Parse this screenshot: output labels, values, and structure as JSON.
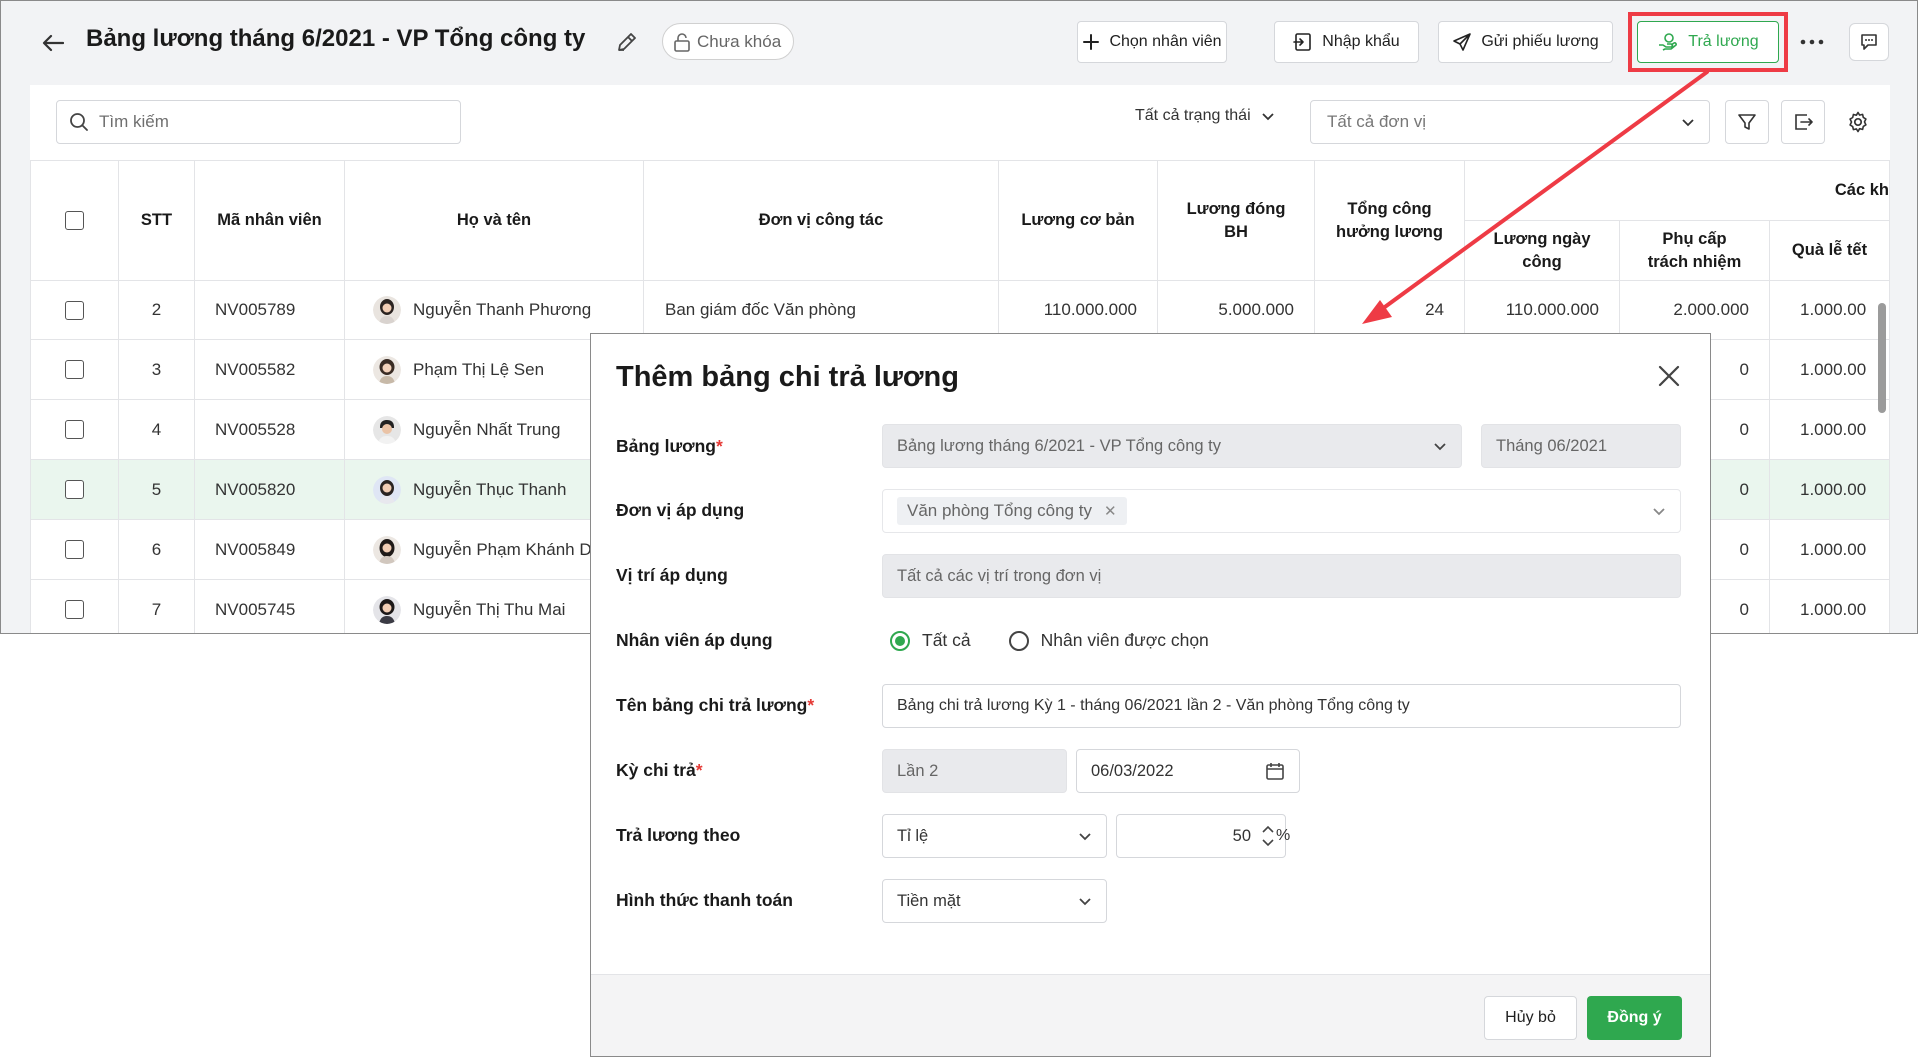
{
  "header": {
    "title": "Bảng lương tháng 6/2021 - VP Tổng công ty",
    "lock_status": "Chưa khóa",
    "buttons": {
      "choose_employee": "Chọn nhân viên",
      "import": "Nhập khẩu",
      "send_payslip": "Gửi phiếu lương",
      "pay_salary": "Trả lương"
    }
  },
  "toolbar": {
    "search_placeholder": "Tìm kiếm",
    "status_filter": "Tất cả trạng thái",
    "unit_filter": "Tất cả đơn vị"
  },
  "table": {
    "columns": {
      "stt": "STT",
      "employee_code": "Mã nhân viên",
      "full_name": "Họ và tên",
      "department": "Đơn vị công tác",
      "base_salary": "Lương cơ bản",
      "insurance_salary": "Lương đóng BH",
      "total_workdays": "Tổng công hưởng lương",
      "group_header": "Các kh",
      "daily_wage": "Lương ngày công",
      "responsibility_allowance": "Phụ cấp trách nhiệm",
      "holiday_gift": "Quà lễ tết"
    },
    "rows": [
      {
        "stt": "2",
        "code": "NV005789",
        "name": "Nguyễn Thanh Phương",
        "dept": "Ban giám đốc Văn phòng",
        "base": "110.000.000",
        "ins": "5.000.000",
        "days": "24",
        "daily": "110.000.000",
        "allow": "2.000.000",
        "gift": "1.000.00"
      },
      {
        "stt": "3",
        "code": "NV005582",
        "name": "Phạm Thị Lệ Sen",
        "dept": "",
        "base": "",
        "ins": "",
        "days": "",
        "daily": "",
        "allow": "0",
        "gift": "1.000.00"
      },
      {
        "stt": "4",
        "code": "NV005528",
        "name": "Nguyễn Nhất Trung",
        "dept": "",
        "base": "",
        "ins": "",
        "days": "",
        "daily": "",
        "allow": "0",
        "gift": "1.000.00"
      },
      {
        "stt": "5",
        "code": "NV005820",
        "name": "Nguyễn Thục Thanh",
        "dept": "",
        "base": "",
        "ins": "",
        "days": "",
        "daily": "",
        "allow": "0",
        "gift": "1.000.00"
      },
      {
        "stt": "6",
        "code": "NV005849",
        "name": "Nguyễn Phạm Khánh D",
        "dept": "",
        "base": "",
        "ins": "",
        "days": "",
        "daily": "",
        "allow": "0",
        "gift": "1.000.00"
      },
      {
        "stt": "7",
        "code": "NV005745",
        "name": "Nguyễn Thị Thu Mai",
        "dept": "",
        "base": "",
        "ins": "",
        "days": "",
        "daily": "",
        "allow": "0",
        "gift": "1.000.00"
      }
    ]
  },
  "modal": {
    "title": "Thêm bảng chi trả lương",
    "fields": {
      "payroll_label": "Bảng lương",
      "payroll_value": "Bảng lương tháng 6/2021 - VP Tổng công ty",
      "payroll_month": "Tháng 06/2021",
      "unit_label": "Đơn vị áp dụng",
      "unit_chip": "Văn phòng Tổng công ty",
      "position_label": "Vị trí áp dụng",
      "position_value": "Tất cả các vị trí trong đơn vị",
      "employee_label": "Nhân viên áp dụng",
      "employee_option_all": "Tất cả",
      "employee_option_selected": "Nhân viên được chọn",
      "name_label": "Tên bảng chi trả lương",
      "name_value": "Bảng chi trả lương Kỳ 1 - tháng 06/2021 lần 2 - Văn phòng Tổng công ty",
      "period_label": "Kỳ chi trả",
      "period_value": "Lần 2",
      "period_date": "06/03/2022",
      "pay_by_label": "Trả lương theo",
      "pay_by_value": "Tỉ lệ",
      "percent_value": "50",
      "percent_unit": "%",
      "payment_method_label": "Hình thức thanh toán",
      "payment_method_value": "Tiền mặt"
    },
    "buttons": {
      "cancel": "Hủy bỏ",
      "ok": "Đồng ý"
    }
  },
  "colors": {
    "accent_green": "#2fa84f",
    "highlight_red": "#ee3b45"
  }
}
